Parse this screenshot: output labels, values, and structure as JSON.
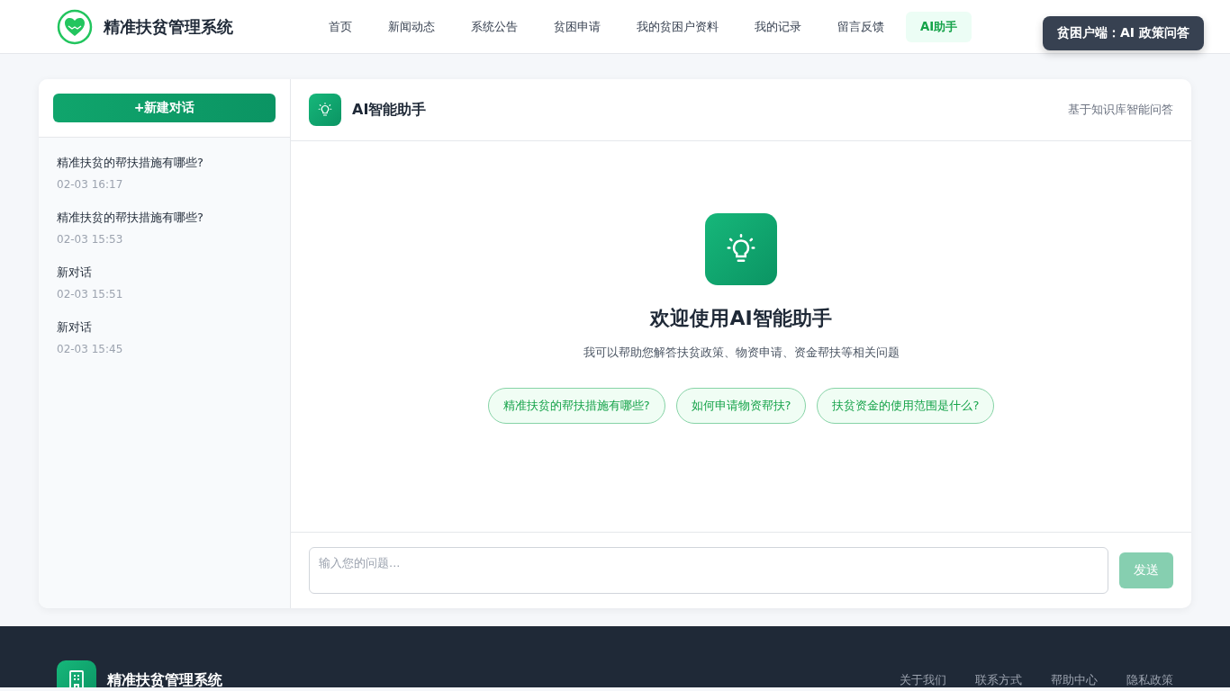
{
  "header": {
    "brand": "精准扶贫管理系统",
    "nav": [
      {
        "label": "首页",
        "selected": false
      },
      {
        "label": "新闻动态",
        "selected": false
      },
      {
        "label": "系统公告",
        "selected": false
      },
      {
        "label": "贫困申请",
        "selected": false
      },
      {
        "label": "我的贫困户资料",
        "selected": false
      },
      {
        "label": "我的记录",
        "selected": false
      },
      {
        "label": "留言反馈",
        "selected": false
      },
      {
        "label": "AI助手",
        "selected": true
      }
    ],
    "tooltip": "贫困户端：AI 政策问答"
  },
  "sidebar": {
    "new_button": "+新建对话",
    "conversations": [
      {
        "title": "精准扶贫的帮扶措施有哪些?",
        "time": "02-03 16:17"
      },
      {
        "title": "精准扶贫的帮扶措施有哪些?",
        "time": "02-03 15:53"
      },
      {
        "title": "新对话",
        "time": "02-03 15:51"
      },
      {
        "title": "新对话",
        "time": "02-03 15:45"
      }
    ]
  },
  "chat": {
    "title": "AI智能助手",
    "subtitle": "基于知识库智能问答",
    "welcome_title": "欢迎使用AI智能助手",
    "welcome_text": "我可以帮助您解答扶贫政策、物资申请、资金帮扶等相关问题",
    "suggestions": [
      "精准扶贫的帮扶措施有哪些?",
      "如何申请物资帮扶?",
      "扶贫资金的使用范围是什么?"
    ],
    "input": {
      "placeholder": "输入您的问题..."
    },
    "send_button": {
      "label": "发送",
      "disabled": true
    }
  },
  "footer": {
    "brand": "精准扶贫管理系统",
    "links": [
      "关于我们",
      "联系方式",
      "帮助中心",
      "隐私政策"
    ]
  }
}
